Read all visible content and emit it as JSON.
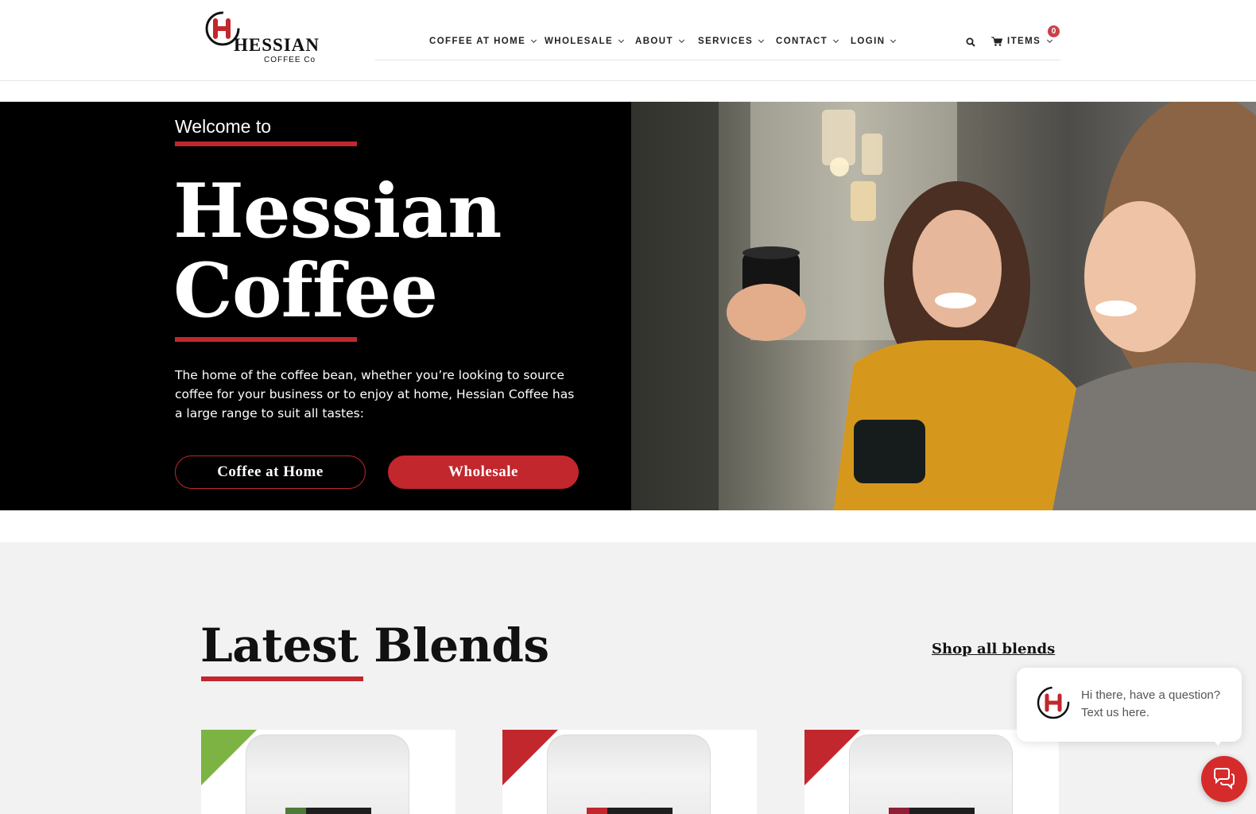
{
  "header": {
    "logo_brand": "HESSIAN",
    "logo_sub": "COFFEE Co",
    "nav": [
      {
        "label": "COFFEE AT HOME"
      },
      {
        "label": "WHOLESALE"
      },
      {
        "label": "ABOUT"
      },
      {
        "label": "SERVICES"
      },
      {
        "label": "CONTACT"
      },
      {
        "label": "LOGIN"
      }
    ],
    "cart_label": "ITEMS",
    "cart_count": "0",
    "icons": [
      "search-icon",
      "cart-icon",
      "chevron-down-icon"
    ]
  },
  "hero": {
    "welcome": "Welcome to",
    "title_line1": "Hessian",
    "title_line2": "Coffee",
    "description": "The home of the coffee bean, whether you’re looking to source coffee for your business or to enjoy at home, Hessian Coffee has a large range to suit all tastes:",
    "buttons": [
      {
        "label": "Coffee at Home"
      },
      {
        "label": "Wholesale"
      }
    ]
  },
  "blends": {
    "title": "Latest Blends",
    "shop_all": "Shop all blends",
    "cards": [
      {
        "ribbon_color": "#7cb342",
        "stripe_color": "#4e7a3a"
      },
      {
        "ribbon_color": "#c1272d",
        "stripe_color": "#c1272d"
      },
      {
        "ribbon_color": "#c1272d",
        "stripe_color": "#8e1f35"
      }
    ]
  },
  "chat": {
    "message": "Hi there, have a question? Text us here."
  },
  "colors": {
    "accent": "#c1272d",
    "hero_bg": "#000000",
    "section_bg": "#f2f2f2",
    "chat_button": "#d62b2b"
  }
}
